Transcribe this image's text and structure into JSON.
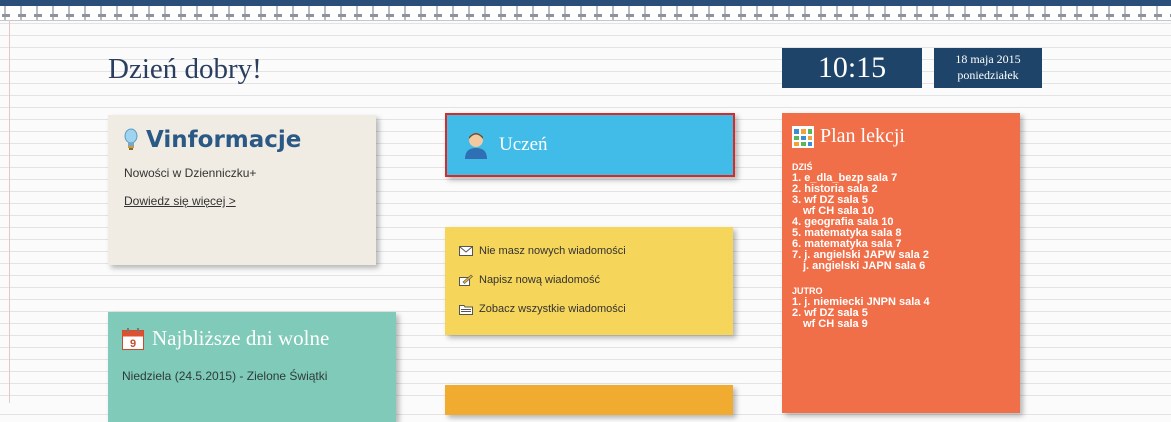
{
  "greeting": "Dzień dobry!",
  "clock": {
    "time": "10:15",
    "date": "18 maja 2015",
    "weekday": "poniedziałek"
  },
  "vinfo": {
    "title": "Vinformacje",
    "description": "Nowości w Dzienniczku+",
    "link": "Dowiedz się więcej >"
  },
  "student": {
    "label": "Uczeń"
  },
  "messages": {
    "items": [
      {
        "icon": "envelope-icon",
        "label": "Nie masz nowych wiadomości"
      },
      {
        "icon": "write-message-icon",
        "label": "Napisz nową wiadomość"
      },
      {
        "icon": "folder-icon",
        "label": "Zobacz wszystkie wiadomości"
      }
    ]
  },
  "plan": {
    "title": "Plan lekcji",
    "today_label": "DZIŚ",
    "today": [
      {
        "num": "1.",
        "text": "e_dla_bezp sala 7"
      },
      {
        "num": "2.",
        "text": "historia sala 2"
      },
      {
        "num": "3.",
        "text": "wf DZ sala 5",
        "extra": "wf CH sala 10"
      },
      {
        "num": "4.",
        "text": "geografia sala 10"
      },
      {
        "num": "5.",
        "text": "matematyka sala 8"
      },
      {
        "num": "6.",
        "text": "matematyka sala 7"
      },
      {
        "num": "7.",
        "text": "j. angielski JAPW sala 2",
        "extra": "j. angielski JAPN sala 6"
      }
    ],
    "tomorrow_label": "JUTRO",
    "tomorrow": [
      {
        "num": "1.",
        "text": "j. niemiecki JNPN sala 4"
      },
      {
        "num": "2.",
        "text": "wf DZ sala 5",
        "extra": "wf CH sala 9"
      }
    ]
  },
  "holidays": {
    "title": "Najbliższe dni wolne",
    "calendar_day": "9",
    "entry": "Niedziela (24.5.2015) - Zielone Świątki"
  },
  "colors": {
    "navy": "#1f4469",
    "student_tile": "#41bce8",
    "messages_tile": "#f5d55a",
    "plan_tile": "#f06e48",
    "holidays_tile": "#7fcab9",
    "vinfo_tile": "#f0ece4"
  }
}
